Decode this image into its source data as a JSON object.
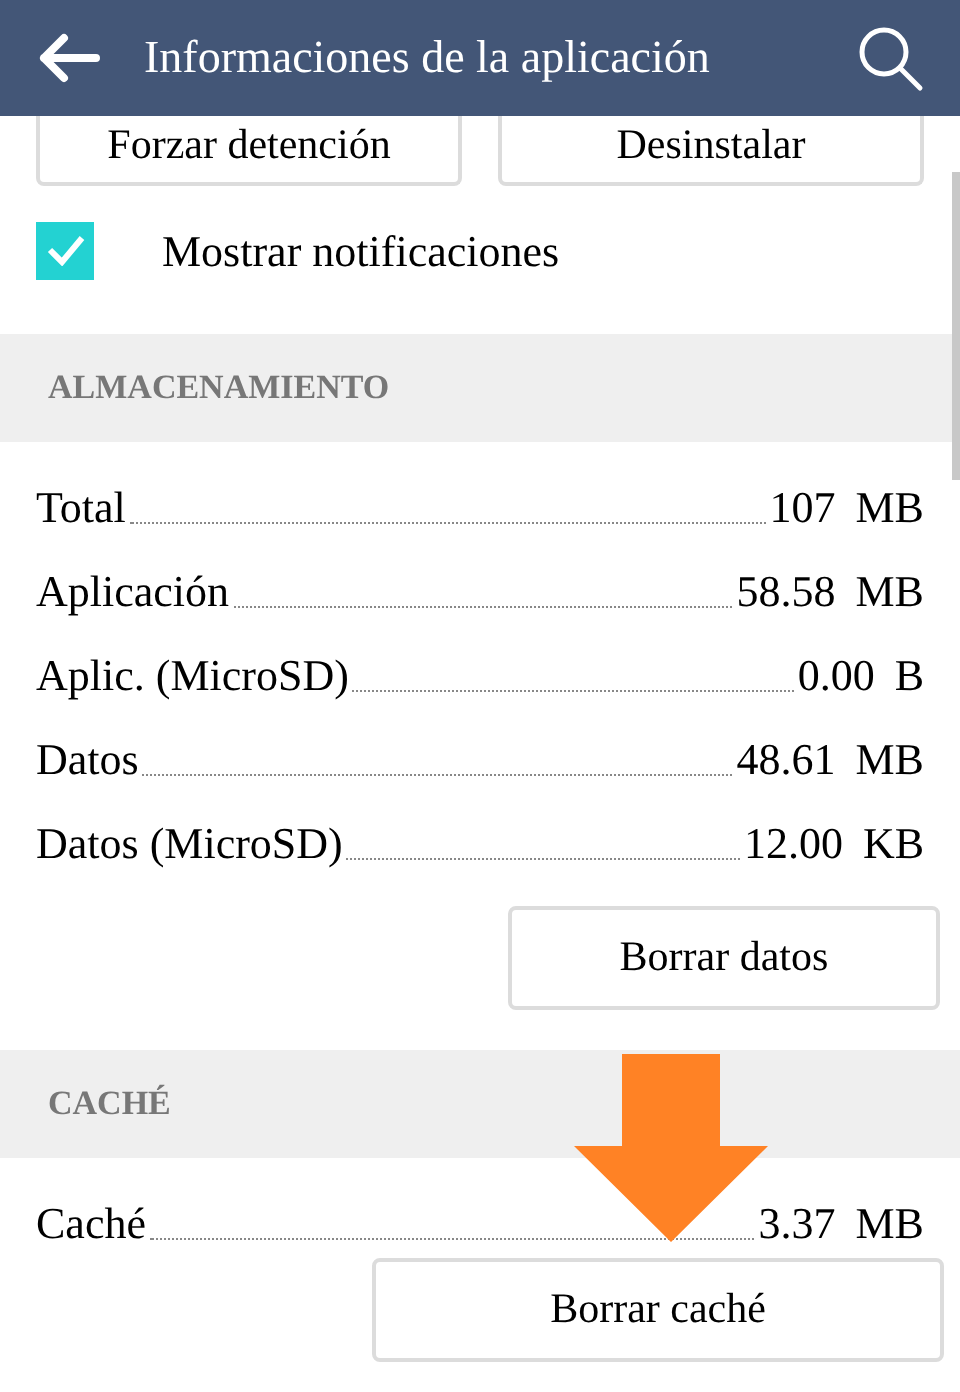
{
  "app_bar": {
    "title": "Informaciones de la aplicación"
  },
  "top_buttons": [
    "Forzar detención",
    "Desinstalar"
  ],
  "notifications": {
    "label": "Mostrar notificaciones",
    "checked": true
  },
  "storage": {
    "heading": "ALMACENAMIENTO",
    "rows": [
      {
        "label": "Total",
        "value": "107",
        "unit": "MB"
      },
      {
        "label": "Aplicación",
        "value": "58.58",
        "unit": "MB"
      },
      {
        "label": "Aplic. (MicroSD)",
        "value": "0.00",
        "unit": "B"
      },
      {
        "label": "Datos",
        "value": "48.61",
        "unit": "MB"
      },
      {
        "label": "Datos (MicroSD)",
        "value": "12.00",
        "unit": "KB"
      }
    ],
    "button": "Borrar datos"
  },
  "cache": {
    "heading": "CACHÉ",
    "rows": [
      {
        "label": "Caché",
        "value": "3.37",
        "unit": "MB"
      }
    ],
    "button": "Borrar caché"
  }
}
